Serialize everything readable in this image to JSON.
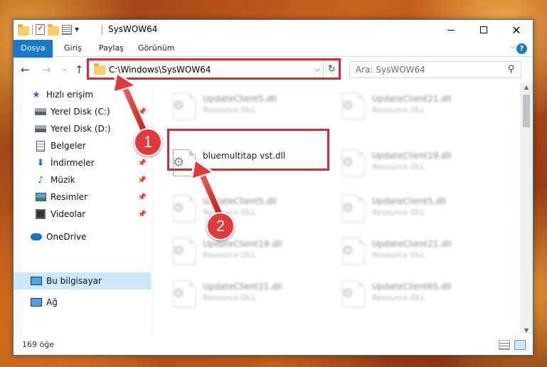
{
  "window": {
    "title": "SysWOW64"
  },
  "ribbon": {
    "tabs": [
      "Dosya",
      "Giriş",
      "Paylaş",
      "Görünüm"
    ]
  },
  "nav": {
    "address": "C:\\Windows\\SysWOW64",
    "search_placeholder": "Ara: SysWOW64"
  },
  "sidebar": {
    "items": [
      {
        "label": "Hızlı erişim",
        "icon": "star-icon"
      },
      {
        "label": "Yerel Disk (C:)",
        "icon": "drive-icon",
        "pinned": true
      },
      {
        "label": "Yerel Disk (D:)",
        "icon": "drive-icon",
        "pinned": false
      },
      {
        "label": "Belgeler",
        "icon": "documents-icon",
        "pinned": true
      },
      {
        "label": "İndirmeler",
        "icon": "downloads-icon",
        "pinned": true
      },
      {
        "label": "Müzik",
        "icon": "music-icon",
        "pinned": true
      },
      {
        "label": "Resimler",
        "icon": "pictures-icon",
        "pinned": true
      },
      {
        "label": "Videolar",
        "icon": "videos-icon",
        "pinned": true
      },
      {
        "label": "OneDrive",
        "icon": "onedrive-icon"
      },
      {
        "label": "Bu bilgisayar",
        "icon": "this-pc-icon",
        "selected": true
      },
      {
        "label": "Ağ",
        "icon": "network-icon"
      }
    ]
  },
  "files": {
    "highlighted": {
      "name": "bluemultitap vst.dll"
    },
    "left_column": [
      {
        "name": "UpdateClient5.dll",
        "type": "Resource DLL"
      },
      {
        "name": "UpdateClient5.dll",
        "type": "Resource DLL"
      },
      {
        "name": "UpdateClient19.dll",
        "type": "Resource DLL"
      },
      {
        "name": "UpdateClient21.dll",
        "type": "Resource DLL"
      }
    ],
    "right_column": [
      {
        "name": "UpdateClient21.dll",
        "type": "Resource DLL"
      },
      {
        "name": "UpdateClient19.dll",
        "type": "Resource DLL"
      },
      {
        "name": "UpdateClient5.dll",
        "type": "Resource DLL"
      },
      {
        "name": "UpdateClient21.dll",
        "type": "Resource DLL"
      },
      {
        "name": "UpdateClient65.dll",
        "type": "Resource DLL"
      }
    ]
  },
  "status": {
    "count": "169 öğe"
  },
  "callouts": {
    "one": "1",
    "two": "2"
  },
  "colors": {
    "accent": "#1979ca",
    "highlight": "#d9282f",
    "selection": "#cce8ff"
  }
}
